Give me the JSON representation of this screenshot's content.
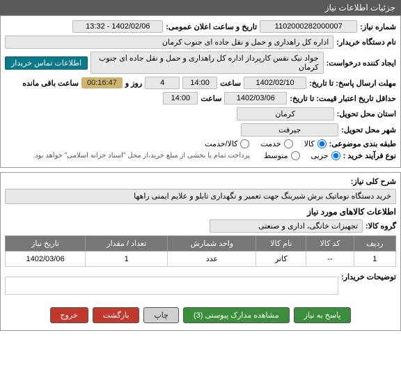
{
  "header": {
    "title": "جزئیات اطلاعات نیاز"
  },
  "fields": {
    "need_no_label": "شماره نیاز:",
    "need_no": "1102000282000007",
    "announce_label": "تاریخ و ساعت اعلان عمومی:",
    "announce_value": "1402/02/06 - 13:32",
    "buyer_label": "نام دستگاه خریدار:",
    "buyer": "اداره کل راهداری و حمل و نقل جاده ای جنوب کرمان",
    "requester_label": "ایجاد کننده درخواست:",
    "requester": "جواد  نیک نفس کارپرداز اداره کل راهداری و حمل و نقل جاده ای جنوب کرمان",
    "contact_btn": "اطلاعات تماس خریدار",
    "reply_deadline_label": "مهلت ارسال پاسخ: تا تاریخ:",
    "reply_date": "1402/02/10",
    "time_label": "ساعت",
    "reply_time": "14:00",
    "day_label": "روز و",
    "days": "4",
    "timer": "00:16:47",
    "remain_label": "ساعت باقی مانده",
    "validity_label": "حداقل تاریخ اعتبار قیمت: تا تاریخ:",
    "validity_date": "1402/03/06",
    "validity_time": "14:00",
    "province_label": "استان محل تحویل:",
    "province": "کرمان",
    "city_label": "شهر محل تحویل:",
    "city": "جیرفت",
    "category_label": "طبقه بندی موضوعی:",
    "cat_goods": "کالا",
    "cat_service": "خدمت",
    "cat_goods_service": "کالا/خدمت",
    "process_label": "نوع فرآیند خرید :",
    "proc_small": "جزیی",
    "proc_medium": "متوسط",
    "proc_note": "پرداخت تمام یا بخشی از مبلغ خرید،از محل \"اسناد خزانه اسلامی\" خواهد بود.",
    "desc_label": "شرح کلی نیاز:",
    "desc": "خرید دستگاه نوماتیک برش شیرینگ جهت تعمیر و نگهداری تابلو و علایم ایمنی راهها",
    "items_section": "اطلاعات کالاهای مورد نیاز",
    "group_label": "گروه کالا:",
    "group": "تجهیزات خانگی، اداری و صنعتی",
    "buyer_note_label": "توضیحات خریدار:"
  },
  "table": {
    "headers": {
      "row": "ردیف",
      "code": "کد کالا",
      "name": "نام کالا",
      "unit": "واحد شمارش",
      "qty": "تعداد / مقدار",
      "date": "تاریخ نیاز"
    },
    "rows": [
      {
        "row": "1",
        "code": "--",
        "name": "کاتر",
        "unit": "عدد",
        "qty": "1",
        "date": "1402/03/06"
      }
    ]
  },
  "buttons": {
    "reply": "پاسخ به نیاز",
    "attachments": "مشاهده مدارک پیوستی (3)",
    "print": "چاپ",
    "back": "بازگشت",
    "exit": "خروج"
  }
}
